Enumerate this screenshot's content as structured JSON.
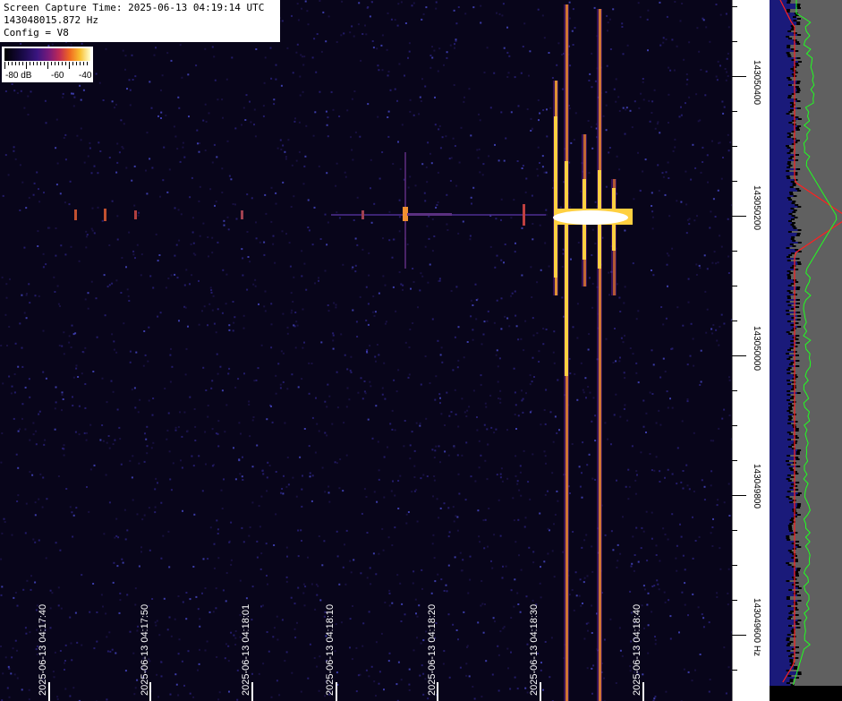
{
  "info": {
    "capture_time": "Screen Capture Time: 2025-06-13 04:19:14 UTC",
    "frequency": "143048015.872 Hz",
    "config": "Config = V8"
  },
  "colorbar": {
    "labels": [
      "-80 dB",
      "-60",
      "-40"
    ]
  },
  "time_axis": {
    "labels": [
      "2025-06-13 04:17:40",
      "2025-06-13 04:17:50",
      "2025-06-13 04:18:01",
      "2025-06-13 04:18:10",
      "2025-06-13 04:18:20",
      "2025-06-13 04:18:30",
      "2025-06-13 04:18:40"
    ]
  },
  "freq_axis": {
    "labels": [
      "143050400",
      "143050200",
      "143050000",
      "143049800",
      "143049600 Hz"
    ]
  },
  "colors": {
    "background": "#08051a",
    "noise": "#2a2a8a",
    "hot": "#ffd040",
    "peak": "#ffffff",
    "spectrum_fill": "#1a1a7a",
    "spectrum_grey": "#606060",
    "avg_line": "#ff2020",
    "peak_line": "#20ff20"
  }
}
